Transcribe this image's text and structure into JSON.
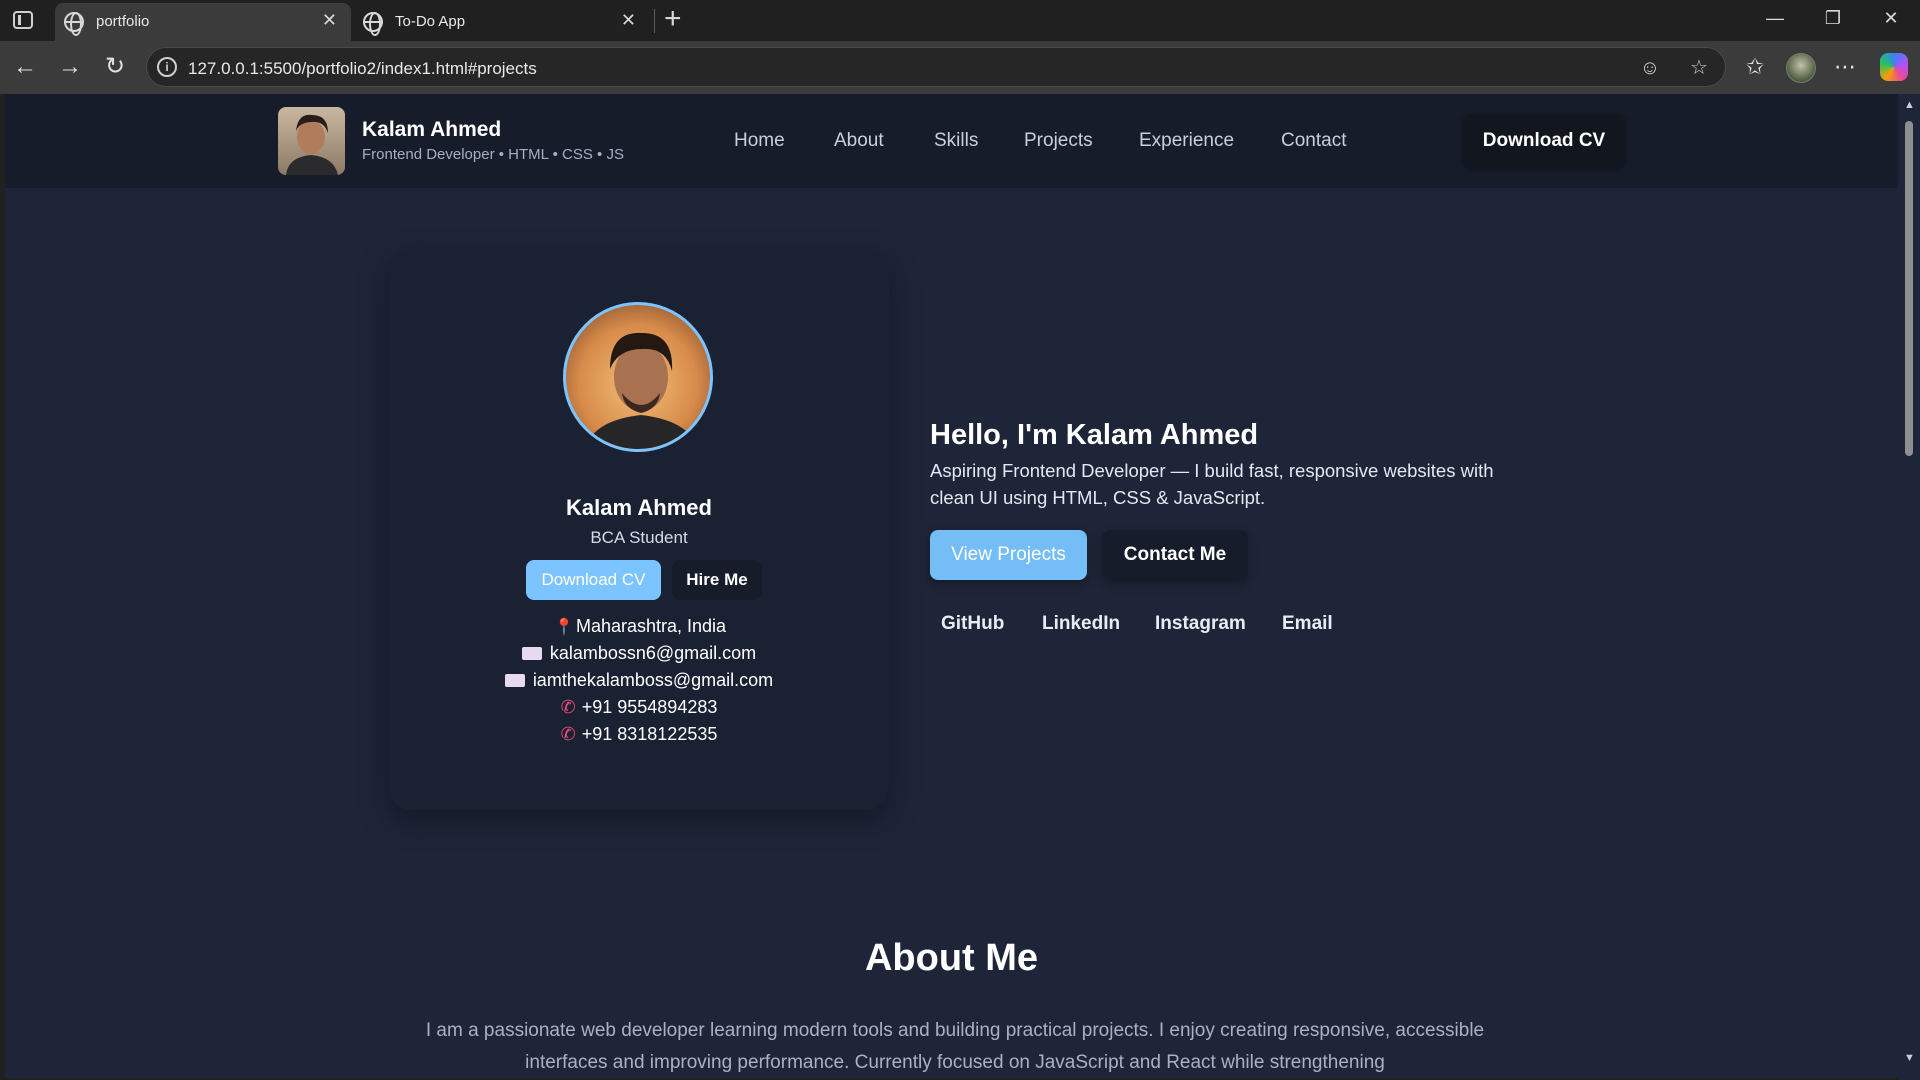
{
  "browser": {
    "tabs": [
      {
        "title": "portfolio",
        "active": true
      },
      {
        "title": "To-Do App",
        "active": false
      }
    ],
    "url": "127.0.0.1:5500/portfolio2/index1.html#projects"
  },
  "site": {
    "brand": {
      "name": "Kalam Ahmed",
      "tagline": "Frontend Developer • HTML • CSS • JS"
    },
    "nav": [
      "Home",
      "About",
      "Skills",
      "Projects",
      "Experience",
      "Contact"
    ],
    "header_cv_label": "Download CV"
  },
  "profile_card": {
    "name": "Kalam Ahmed",
    "role": "BCA Student",
    "download_cv_label": "Download CV",
    "hire_label": "Hire Me",
    "location": "Maharashtra, India",
    "emails": [
      "kalambossn6@gmail.com",
      "iamthekalamboss@gmail.com"
    ],
    "phones": [
      "+91 9554894283",
      "+91 8318122535"
    ]
  },
  "hero": {
    "title": "Hello, I'm Kalam Ahmed",
    "description": "Aspiring Frontend Developer — I build fast, responsive websites with clean UI using HTML, CSS & JavaScript.",
    "view_projects_label": "View Projects",
    "contact_label": "Contact Me",
    "social": [
      "GitHub",
      "LinkedIn",
      "Instagram",
      "Email"
    ]
  },
  "about": {
    "title": "About Me",
    "text": "I am a passionate web developer learning modern tools and building practical projects. I enjoy creating responsive, accessible interfaces and improving performance. Currently focused on JavaScript and React while strengthening"
  },
  "colors": {
    "page_bg": "#1e2538",
    "header_bg": "#161c29",
    "card_bg": "#1a2133",
    "accent": "#7cc4ff"
  }
}
